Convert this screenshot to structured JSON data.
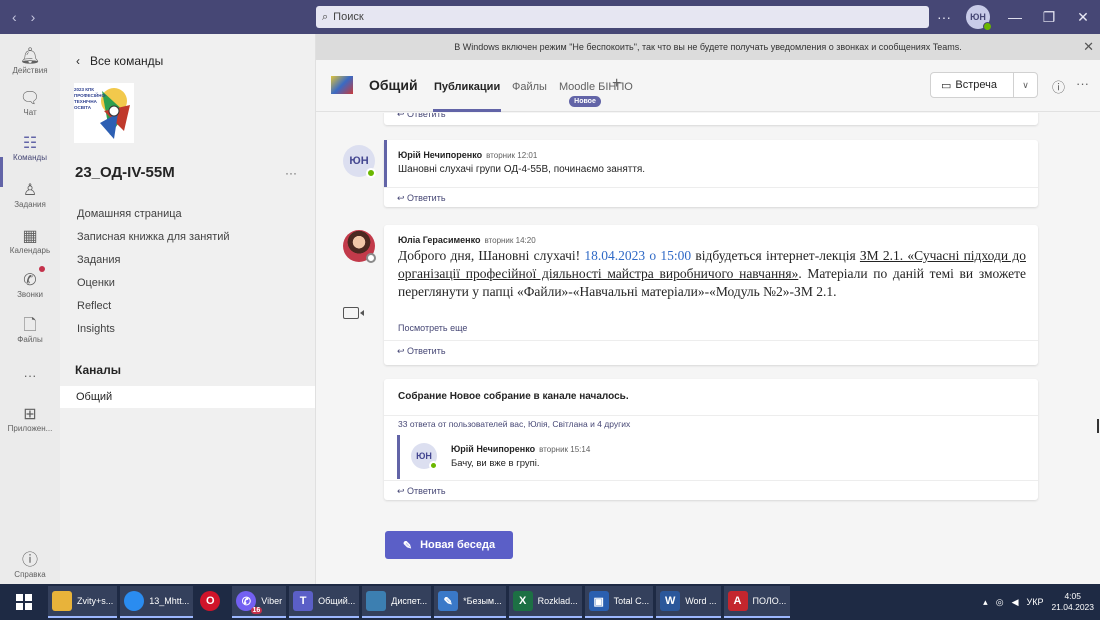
{
  "titlebar": {
    "back_icon": "chevron-left",
    "forward_icon": "chevron-right",
    "search_placeholder": "Поиск",
    "more": "···",
    "avatar_initials": "ЮН"
  },
  "rail": {
    "items": [
      {
        "label": "Действия",
        "icon": "bell"
      },
      {
        "label": "Чат",
        "icon": "chat"
      },
      {
        "label": "Команды",
        "icon": "teams"
      },
      {
        "label": "Задания",
        "icon": "assignments"
      },
      {
        "label": "Календарь",
        "icon": "calendar"
      },
      {
        "label": "Звонки",
        "icon": "phone"
      },
      {
        "label": "Файлы",
        "icon": "file"
      },
      {
        "label": "···",
        "icon": "more"
      },
      {
        "label": "Приложен...",
        "icon": "apps"
      },
      {
        "label": "Справка",
        "icon": "help"
      }
    ]
  },
  "team": {
    "back_label": "Все команды",
    "logo_text": "2023 КПК ПРОФЕСІЙНО-ТЕХНІЧНА ОСВІТА",
    "name": "23_ОД-IV-55М",
    "more": "···",
    "links": [
      "Домашняя страница",
      "Записная книжка для занятий",
      "Задания",
      "Оценки",
      "Reflect",
      "Insights"
    ],
    "channels_heading": "Каналы",
    "channel": "Общий"
  },
  "banner": {
    "text": "В Windows включен режим \"Не беспокоить\", так что вы не будете получать уведомления о звонках и сообщениях Teams."
  },
  "header": {
    "title": "Общий",
    "tabs": [
      "Публикации",
      "Файлы",
      "Moodle БІНПО"
    ],
    "new_badge": "Новое",
    "meet_label": "Встреча",
    "colors": {
      "accent": "#6264a7"
    }
  },
  "feed": {
    "reply_label": "Ответить",
    "posts": [
      {
        "initials": "ЮН",
        "author": "Юрій Нечипоренко",
        "time": "вторник 12:01",
        "text": "Шановні слухачі групи ОД-4-55В, починаємо заняття."
      },
      {
        "author": "Юліа Герасименко",
        "time": "вторник 14:20",
        "text_a": "Доброго дня, Шановні слухачі! ",
        "text_b": "18.04.2023 о 15:00",
        "text_c": " відбудеться інтернет-лекція ",
        "text_d": "ЗМ 2.1. «Сучасні підходи до організації професійної діяльності майстра виробничого навчання»",
        "text_e": ". Матеріали по даній темі ви зможете переглянути у папці «Файли»-«Навчальні матеріали»-«Модуль №2»-ЗМ 2.1.",
        "see_more": "Посмотреть еще"
      }
    ],
    "meeting": {
      "title": "Собрание Новое собрание в канале началось.",
      "replies_summary": "33 ответа от пользователей вас, Юлія, Світлана и 4 других",
      "reply": {
        "initials": "ЮН",
        "author": "Юрій Нечипоренко",
        "time": "вторник 15:14",
        "text": "Бачу, ви вже в групі."
      }
    },
    "new_conversation": "Новая беседа"
  },
  "taskbar": {
    "items": [
      {
        "label": "Zvity+s...",
        "icon": "folder",
        "color": "#e8b33a"
      },
      {
        "label": "13_Mhtt...",
        "icon": "chrome",
        "color": "#2a8cf0"
      },
      {
        "label": "",
        "icon": "opera",
        "color": "#d0142a"
      },
      {
        "label": "Viber",
        "icon": "viber",
        "color": "#7360f2",
        "count": "16"
      },
      {
        "label": "Общий...",
        "icon": "teams",
        "color": "#5b5fc7"
      },
      {
        "label": "Диспет...",
        "icon": "task-manager",
        "color": "#3c7fb1"
      },
      {
        "label": "*Безым...",
        "icon": "paint",
        "color": "#3a79c8"
      },
      {
        "label": "Rozklad...",
        "icon": "excel",
        "color": "#1d7044"
      },
      {
        "label": "Total C...",
        "icon": "total-commander",
        "color": "#2a5fb0"
      },
      {
        "label": "Word ...",
        "icon": "word",
        "color": "#2b579a"
      },
      {
        "label": "ПОЛО...",
        "icon": "pdf",
        "color": "#c4262e"
      }
    ],
    "lang": "УКР",
    "time": "4:05",
    "date": "21.04.2023"
  }
}
